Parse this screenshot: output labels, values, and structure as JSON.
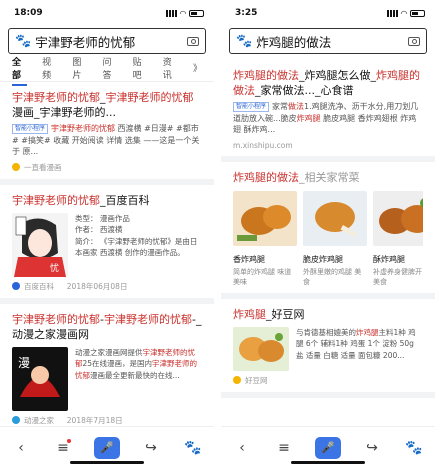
{
  "left": {
    "status": {
      "time": "18:09"
    },
    "search": {
      "query": "宇津野老师的忧郁"
    },
    "tabs": [
      "全部",
      "视频",
      "图片",
      "问答",
      "贴吧",
      "资讯",
      "》"
    ],
    "result1": {
      "title_red1": "宇津野老师的忧郁",
      "title_mid1": "_",
      "title_red2": "宇津野老师的忧郁",
      "title_mid2": "漫画_宇津野老师的...",
      "badge": "智能小程序",
      "desc_red": "宇津野老师的忧郁",
      "desc_rest": " 西渡横 #日漫# #都市# #搞笑# 收藏 开始阅读 详情 选集 ——这是一个关于 原...",
      "source": "一直看漫画"
    },
    "result2": {
      "title_red": "宇津野老师的忧郁",
      "title_rest": "_百度百科",
      "type": "类型：  漫画作品",
      "author": "作者：  西渡横",
      "intro": "简介：  《宇津野老师的忧郁》是由日本画家 西渡横 创作的漫画作品。",
      "source": "百度百科",
      "date": "2018年06月08日"
    },
    "result3": {
      "title_red1": "宇津野老师的忧郁",
      "title_mid": "-",
      "title_red2": "宇津野老师的忧郁",
      "title_rest": "-_动漫之家漫画网",
      "desc_a": "动漫之家漫画网提供",
      "desc_red1": "宇津野老师的忧郁",
      "desc_b": "25在线漫画，是国内",
      "desc_red2": "宇津野老师的忧郁",
      "desc_c": "漫画最全更新最快的在线...",
      "source": "动漫之家",
      "date": "2018年7月18日"
    }
  },
  "right": {
    "status": {
      "time": "3:25"
    },
    "search": {
      "query": "炸鸡腿的做法"
    },
    "result1": {
      "title_red1": "炸鸡腿的做法",
      "title_mid": "_炸鸡腿怎么做_",
      "title_red2": "炸鸡腿的做法",
      "title_rest": "_家常做法..._心食谱",
      "badge": "智能小程序",
      "desc_a": "家常",
      "desc_red1": "做法",
      "desc_b": "1.鸡腿洗净、沥干水分,用刀划几道肋放入碗...脆皮",
      "desc_red2": "炸鸡腿",
      "desc_c": " 脆皮鸡腿 香炸鸡翅根 炸鸡翅 酥炸鸡...",
      "url": "m.xinshipu.com"
    },
    "result2": {
      "title_red": "炸鸡腿的做法",
      "title_rest": "_相关家常菜",
      "items": [
        {
          "name": "香炸鸡腿",
          "sub": "简单的炸鸡腿 味道美味"
        },
        {
          "name": "脆皮炸鸡腿",
          "sub": "外酥里嫩的鸡腿 美食"
        },
        {
          "name": "酥炸鸡腿",
          "sub": "补虚养身健脾开 胃美食"
        },
        {
          "name": "香",
          "sub": "可 食"
        }
      ]
    },
    "result3": {
      "title_red": "炸鸡腿",
      "title_rest": "_好豆网",
      "desc_a": "与肯德基相媲美的",
      "desc_red": "炸鸡腿",
      "desc_b": "主料1种 鸡腿 6个 辅料1种 鸡蛋 1个 淀粉 50g 盐 适量 白糖 适量 面包糠 200...",
      "source": "好豆网"
    }
  },
  "colors": {
    "accent": "#2b63d9",
    "highlight": "#c9302c"
  }
}
